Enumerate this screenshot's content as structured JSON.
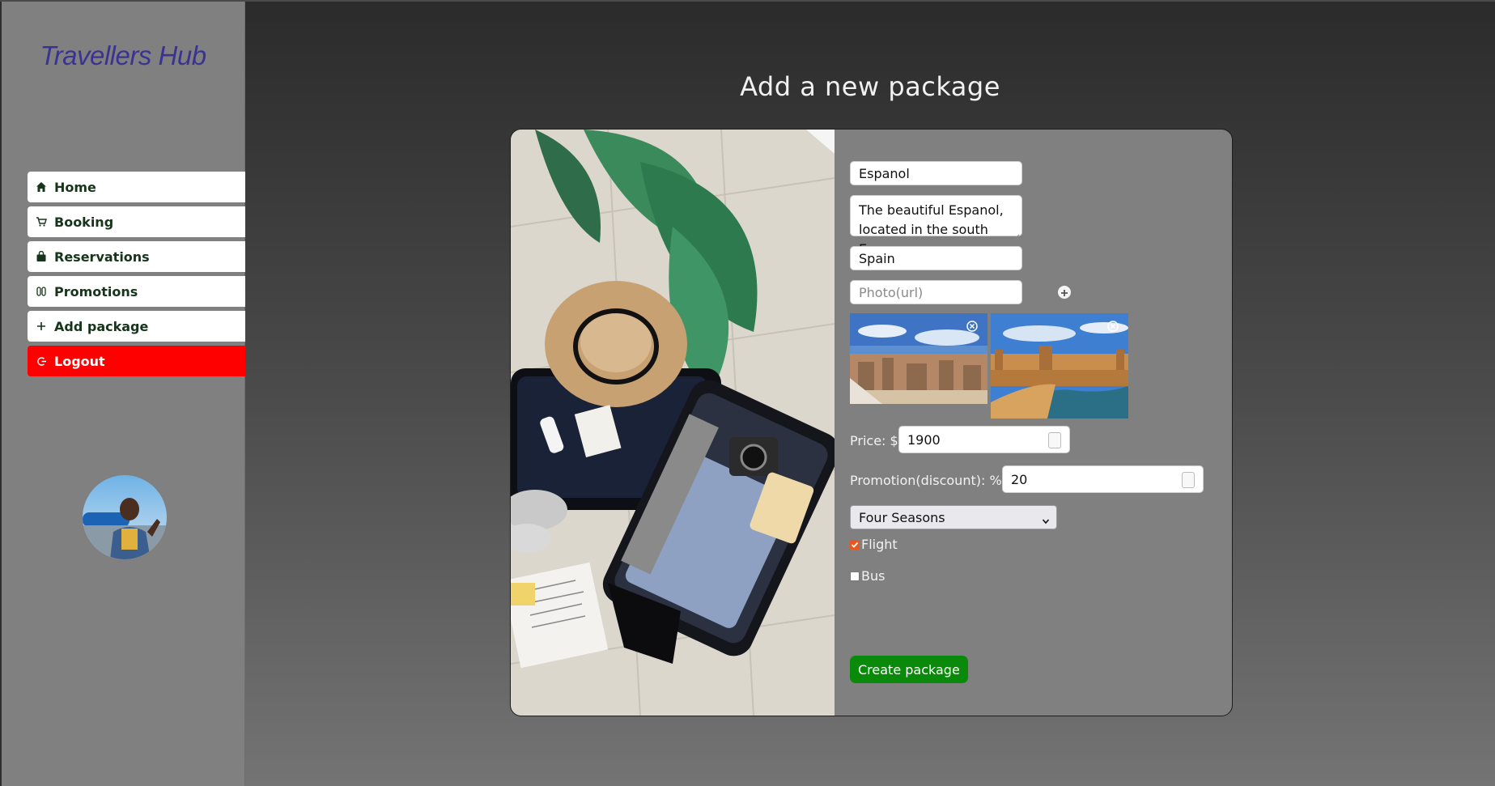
{
  "app": {
    "brand": "Travellers Hub"
  },
  "sidebar": {
    "items": [
      {
        "label": "Home",
        "icon": "home-icon"
      },
      {
        "label": "Booking",
        "icon": "cart-icon"
      },
      {
        "label": "Reservations",
        "icon": "bag-icon"
      },
      {
        "label": "Promotions",
        "icon": "gift-icon"
      },
      {
        "label": "Add package",
        "icon": "plus-icon"
      },
      {
        "label": "Logout",
        "icon": "logout-icon"
      }
    ],
    "logout_color": "#ff0000"
  },
  "main": {
    "title": "Add a new package"
  },
  "form": {
    "name_value": "Espanol",
    "description_value": "The beautiful Espanol, located in the south Europe,",
    "country_value": "Spain",
    "photo_placeholder": "Photo(url)",
    "price_label": "Price: $",
    "price_value": "1900",
    "promotion_label": "Promotion(discount): %",
    "promotion_value": "20",
    "hotel_selected": "Four Seasons",
    "flight_label": "Flight",
    "flight_checked": true,
    "bus_label": "Bus",
    "bus_checked": false,
    "submit_label": "Create package",
    "submit_color": "#0a8a0a"
  }
}
